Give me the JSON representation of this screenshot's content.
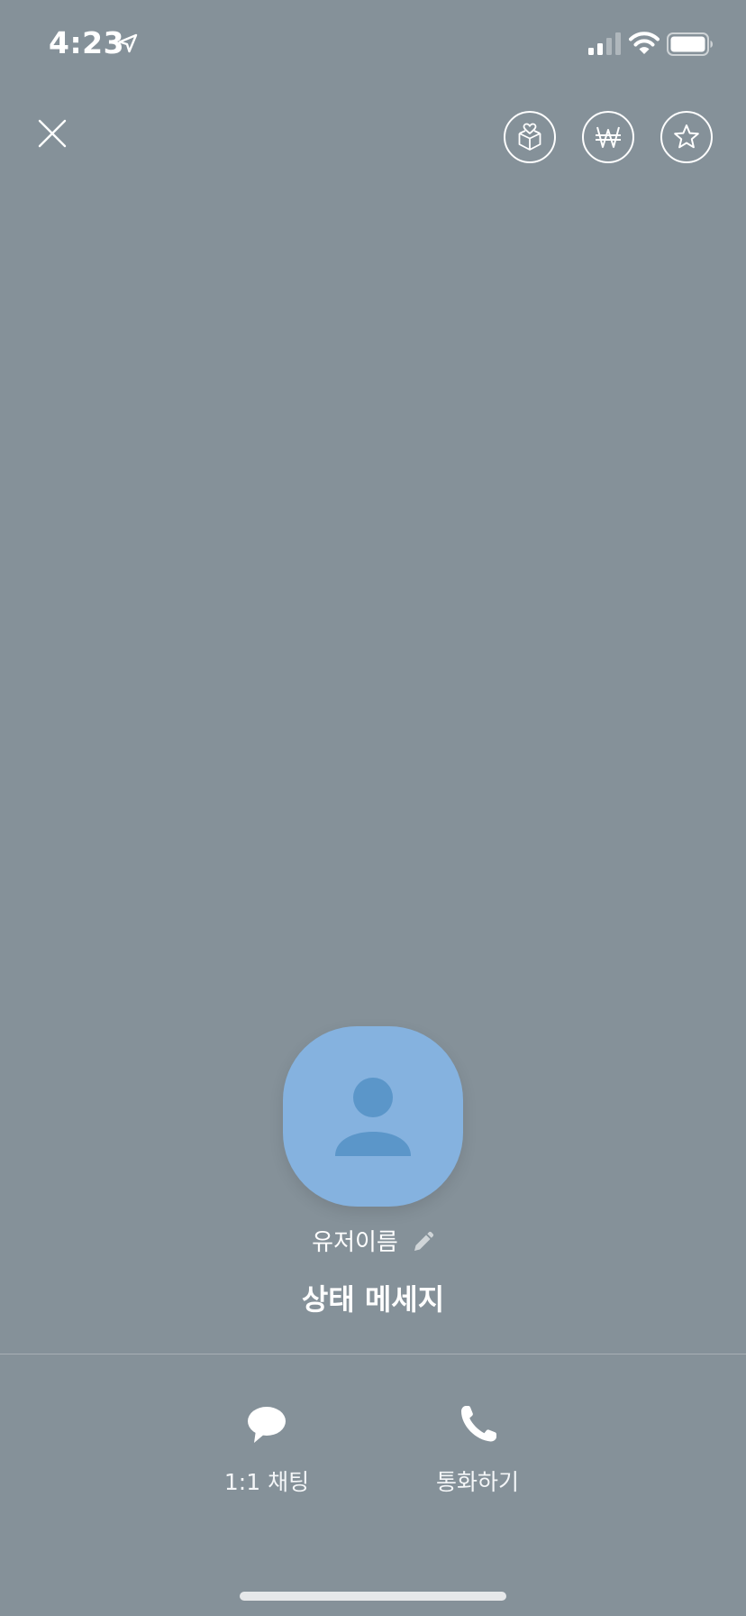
{
  "status_bar": {
    "time": "4:23"
  },
  "top_bar": {
    "close_icon": "close-icon",
    "buttons": [
      "gift-icon",
      "won-icon",
      "star-icon"
    ]
  },
  "profile": {
    "avatar_icon": "person-icon",
    "avatar_color": "#85b2df",
    "name": "유저이름",
    "status_message": "상태 메세지"
  },
  "actions": {
    "chat_label": "1:1 채팅",
    "call_label": "통화하기"
  },
  "colors": {
    "background": "#859199",
    "avatar_figure": "#5b96c9"
  }
}
